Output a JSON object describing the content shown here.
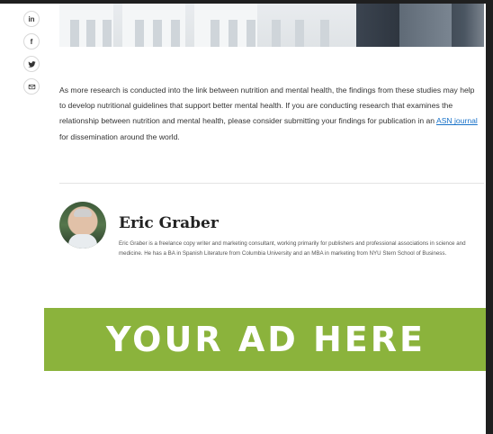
{
  "share": {
    "linkedin_label": "in",
    "facebook_label": "f",
    "twitter_label": "",
    "email_label": ""
  },
  "article": {
    "paragraph_before_link": "As more research is conducted into the link between nutrition and mental health, the findings from these studies may help to develop nutritional guidelines that support better mental health.  If you are conducting research that examines the relationship between nutrition and mental health, please consider submitting your findings for publication in an ",
    "link_text": "ASN journal",
    "paragraph_after_link": " for dissemination around the world."
  },
  "author": {
    "name": "Eric Graber",
    "bio": "Eric Graber is a freelance copy writer and marketing consultant, working primarily for publishers and professional associations in science and medicine.  He has a BA in Spanish Literature from Columbia University and an MBA in marketing from NYU Stern School of Business."
  },
  "ad": {
    "text": "YOUR AD HERE",
    "color": "#8bb33c"
  },
  "colors": {
    "link": "#1a73c9",
    "background_dark": "#1f1f1f"
  }
}
